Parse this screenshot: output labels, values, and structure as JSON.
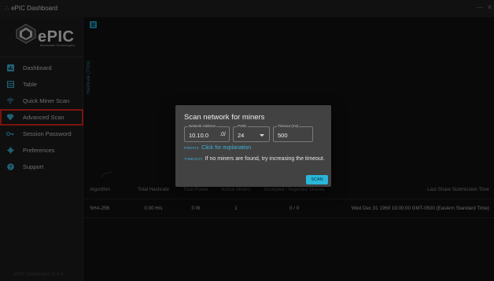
{
  "window": {
    "title": "ePIC Dashboard",
    "minimize": "—",
    "close": "✕"
  },
  "logo": {
    "name": "ePIC",
    "subtitle": "Blockchain Technologies"
  },
  "sidebar": {
    "items": [
      {
        "label": "Dashboard",
        "icon": "dashboard-icon"
      },
      {
        "label": "Table",
        "icon": "table-icon"
      },
      {
        "label": "Quick Miner Scan",
        "icon": "wifi-icon"
      },
      {
        "label": "Advanced Scan",
        "icon": "diamond-icon",
        "selected": true
      },
      {
        "label": "Session Password",
        "icon": "key-icon"
      },
      {
        "label": "Preferences",
        "icon": "gear-icon"
      },
      {
        "label": "Support",
        "icon": "help-icon"
      }
    ],
    "version": "ePIC Dashboard v1.4.0"
  },
  "chart": {
    "ylabel": "Hashrate (TH/s)"
  },
  "table": {
    "headers": [
      "Algorithm",
      "Total Hashrate",
      "Total Power",
      "Active Miners",
      "Accepted / Rejected Shares",
      "Last Share Submission Time"
    ],
    "rows": [
      [
        "SHA-256",
        "0.00 H/s",
        "0 W",
        "1",
        "0 / 0",
        "Wed Dec 31 1969 19:00:00 GMT-0500 (Eastern Standard Time)"
      ]
    ]
  },
  "dialog": {
    "title": "Scan network for miners",
    "network_address": {
      "label": "Network Address",
      "value": "10.10.0",
      "suffix": ".0/"
    },
    "prefix": {
      "label": "Prefix",
      "value": "24"
    },
    "timeout": {
      "label": "Timeout (ms)",
      "value": "500"
    },
    "prefix_tag": "PREFIX",
    "prefix_link": "Click for explanation",
    "timeout_tag": "TIMEOUT",
    "timeout_text": "If no miners are found, try increasing the timeout.",
    "scan_label": "SCAN"
  },
  "colors": {
    "accent": "#29b6d8",
    "highlight_box": "#e0231c",
    "dialog_bg": "#424242"
  }
}
